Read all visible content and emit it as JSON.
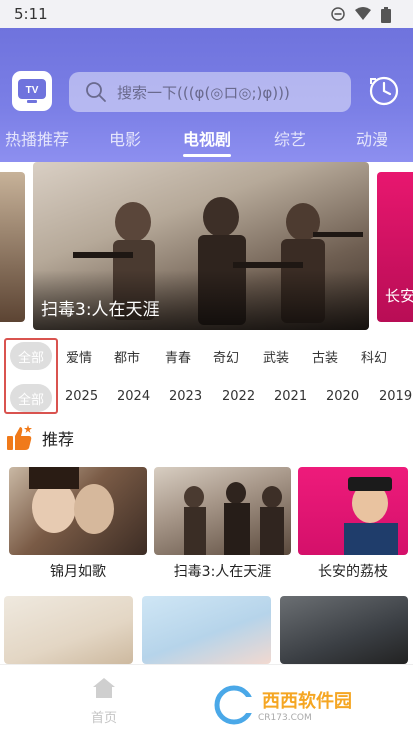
{
  "status_bar": {
    "time": "5:11"
  },
  "search": {
    "placeholder": "搜索一下(((φ(◎ロ◎;)φ)))"
  },
  "logo": {
    "text": "TV"
  },
  "tabs": [
    {
      "label": "热播推荐",
      "active": false
    },
    {
      "label": "电影",
      "active": false
    },
    {
      "label": "电视剧",
      "active": true
    },
    {
      "label": "综艺",
      "active": false
    },
    {
      "label": "动漫",
      "active": false
    }
  ],
  "banners": [
    {
      "title": "扫毒3:人在天涯"
    },
    {
      "title": "长安"
    }
  ],
  "filters": {
    "genre": {
      "all": "全部",
      "options": [
        "爱情",
        "都市",
        "青春",
        "奇幻",
        "武装",
        "古装",
        "科幻"
      ]
    },
    "year": {
      "all": "全部",
      "options": [
        "2025",
        "2024",
        "2023",
        "2022",
        "2021",
        "2020",
        "2019"
      ]
    }
  },
  "recommend": {
    "label": "推荐",
    "cards": [
      {
        "title": "锦月如歌"
      },
      {
        "title": "扫毒3:人在天涯"
      },
      {
        "title": "长安的荔枝"
      }
    ]
  },
  "bottom_nav": {
    "home": "首页"
  },
  "watermark": {
    "brand": "西西软件园",
    "site": "CR173.COM"
  },
  "colors": {
    "header": "#7b7fe6",
    "accent_orange": "#f07a1a",
    "highlight_red": "#d9534f"
  }
}
